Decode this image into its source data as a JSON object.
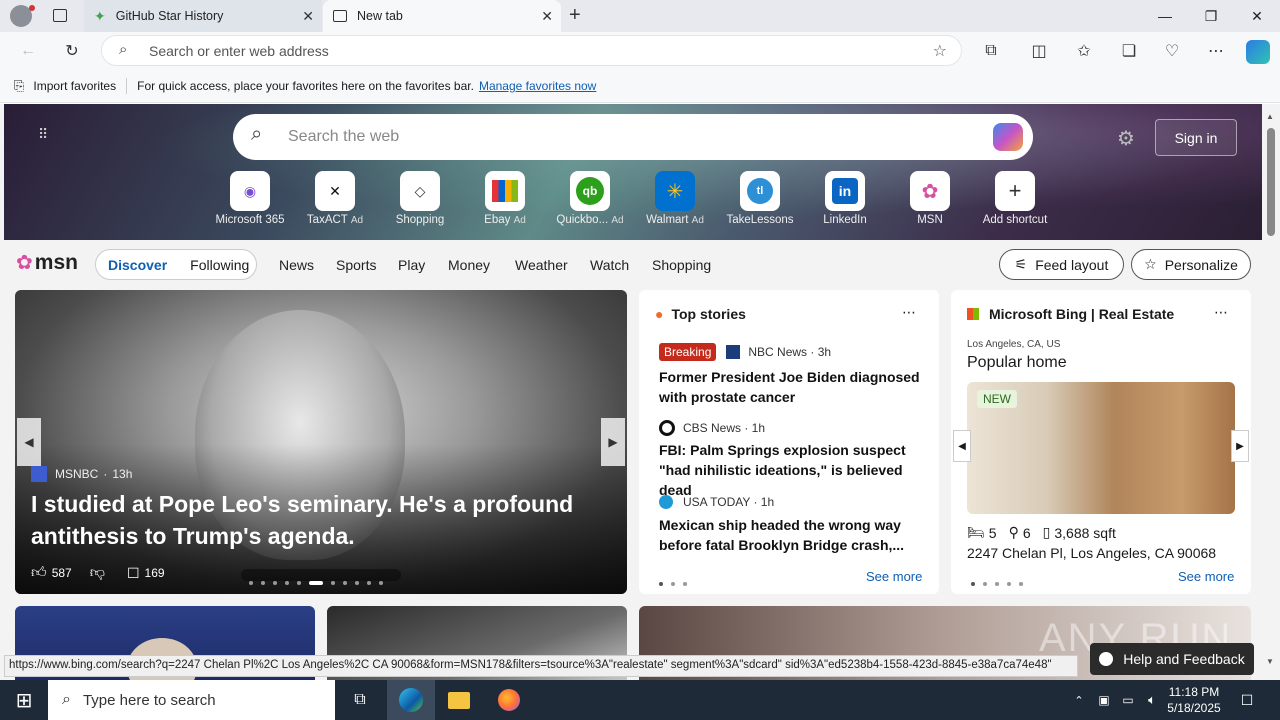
{
  "tabs": [
    {
      "label": "GitHub Star History",
      "active": false
    },
    {
      "label": "New tab",
      "active": true
    }
  ],
  "window_controls": {
    "minimize": "—",
    "restore": "❐",
    "close": "✕"
  },
  "address_bar": {
    "placeholder": "Search or enter web address"
  },
  "favorites_bar": {
    "import_label": "Import favorites",
    "hint": "For quick access, place your favorites here on the favorites bar.",
    "manage_link": "Manage favorites now"
  },
  "newtab": {
    "search_placeholder": "Search the web",
    "signin_label": "Sign in",
    "shortcuts": [
      {
        "label": "Microsoft 365",
        "ad": "",
        "icon": "m365-icon"
      },
      {
        "label": "TaxACT",
        "ad": "Ad",
        "icon": "taxact-icon"
      },
      {
        "label": "Shopping",
        "ad": "",
        "icon": "shopping-tag-icon"
      },
      {
        "label": "Ebay",
        "ad": "Ad",
        "icon": "ebay-icon"
      },
      {
        "label": "Quickbo...",
        "ad": "Ad",
        "icon": "quickbooks-icon"
      },
      {
        "label": "Walmart",
        "ad": "Ad",
        "icon": "walmart-icon"
      },
      {
        "label": "TakeLessons",
        "ad": "",
        "icon": "takelessons-icon"
      },
      {
        "label": "LinkedIn",
        "ad": "",
        "icon": "linkedin-icon"
      },
      {
        "label": "MSN",
        "ad": "",
        "icon": "msn-icon"
      },
      {
        "label": "Add shortcut",
        "ad": "",
        "icon": "plus-icon"
      }
    ]
  },
  "msn": {
    "logo_text": "msn",
    "toggle": [
      "Discover",
      "Following"
    ],
    "nav": [
      "News",
      "Sports",
      "Play",
      "Money",
      "Weather",
      "Watch",
      "Shopping"
    ],
    "feed_layout": "Feed layout",
    "personalize": "Personalize"
  },
  "feature": {
    "source": "MSNBC",
    "age": "13h",
    "title": "I studied at Pope Leo's seminary. He's a profound antithesis to Trump's agenda.",
    "likes": "587",
    "comments": "169"
  },
  "top_stories": {
    "heading": "Top stories",
    "items": [
      {
        "badge": "Breaking",
        "source": "NBC News · 3h",
        "title": "Former President Joe Biden diagnosed with prostate cancer"
      },
      {
        "badge": "",
        "source": "CBS News · 1h",
        "title": "FBI: Palm Springs explosion suspect \"had nihilistic ideations,\" is believed dead"
      },
      {
        "badge": "",
        "source": "USA TODAY · 1h",
        "title": "Mexican ship headed the wrong way before fatal Brooklyn Bridge crash,..."
      }
    ],
    "see_more": "See more"
  },
  "real_estate": {
    "heading": "Microsoft Bing | Real Estate",
    "location": "Los Angeles, CA, US",
    "title": "Popular home",
    "badge": "NEW",
    "beds": "5",
    "baths": "6",
    "sqft": "3,688 sqft",
    "address": "2247 Chelan Pl, Los Angeles, CA 90068",
    "see_more": "See more"
  },
  "status_url": "https://www.bing.com/search?q=2247 Chelan Pl%2C Los Angeles%2C CA 90068&form=MSN178&filters=tsource%3A\"realestate\" segment%3A\"sdcard\" sid%3A\"ed5238b4-1558-423d-8845-e38a7ca74e48\"",
  "help_feedback": "Help and Feedback",
  "taskbar": {
    "search_placeholder": "Type here to search",
    "time": "11:18 PM",
    "date": "5/18/2025"
  },
  "watermark": "ANY RUN"
}
